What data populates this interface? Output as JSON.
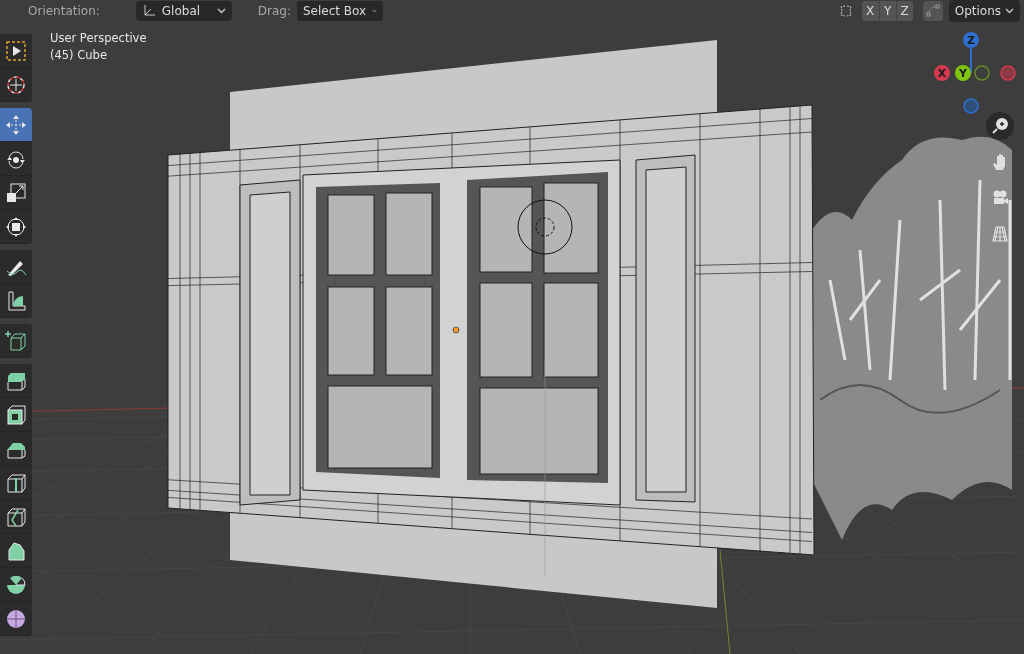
{
  "header": {
    "orientation_label": "Orientation:",
    "orientation_value": "Global",
    "drag_label": "Drag:",
    "drag_value": "Select Box",
    "axis_buttons": [
      "X",
      "Y",
      "Z"
    ],
    "options": "Options"
  },
  "viewport": {
    "view_name": "User Perspective",
    "object_name": "(45) Cube"
  },
  "tool_groups": [
    [
      {
        "kind": "select",
        "selected": false
      },
      {
        "kind": "cursor",
        "selected": false
      }
    ],
    [
      {
        "kind": "move",
        "selected": true
      },
      {
        "kind": "rotate",
        "selected": false
      },
      {
        "kind": "scale",
        "selected": false
      },
      {
        "kind": "transform",
        "selected": false
      }
    ],
    [
      {
        "kind": "annotate",
        "selected": false
      },
      {
        "kind": "measure",
        "selected": false
      }
    ],
    [
      {
        "kind": "addcube",
        "selected": false
      }
    ],
    [
      {
        "kind": "extrude",
        "selected": false
      },
      {
        "kind": "inset",
        "selected": false
      },
      {
        "kind": "bevel",
        "selected": false
      },
      {
        "kind": "loopcut",
        "selected": false
      },
      {
        "kind": "knife",
        "selected": false
      },
      {
        "kind": "polybuild",
        "selected": false
      },
      {
        "kind": "spin",
        "selected": false
      },
      {
        "kind": "smooth",
        "selected": false
      }
    ]
  ],
  "gizmo": [
    {
      "label": "Z",
      "color": "#2e6fd1"
    },
    {
      "label": "X",
      "color": "#d43a4e"
    },
    {
      "label": "Y",
      "color": "#80c40e"
    }
  ],
  "nav": [
    {
      "kind": "zoom"
    },
    {
      "kind": "pan"
    },
    {
      "kind": "camera"
    },
    {
      "kind": "ortho"
    }
  ]
}
